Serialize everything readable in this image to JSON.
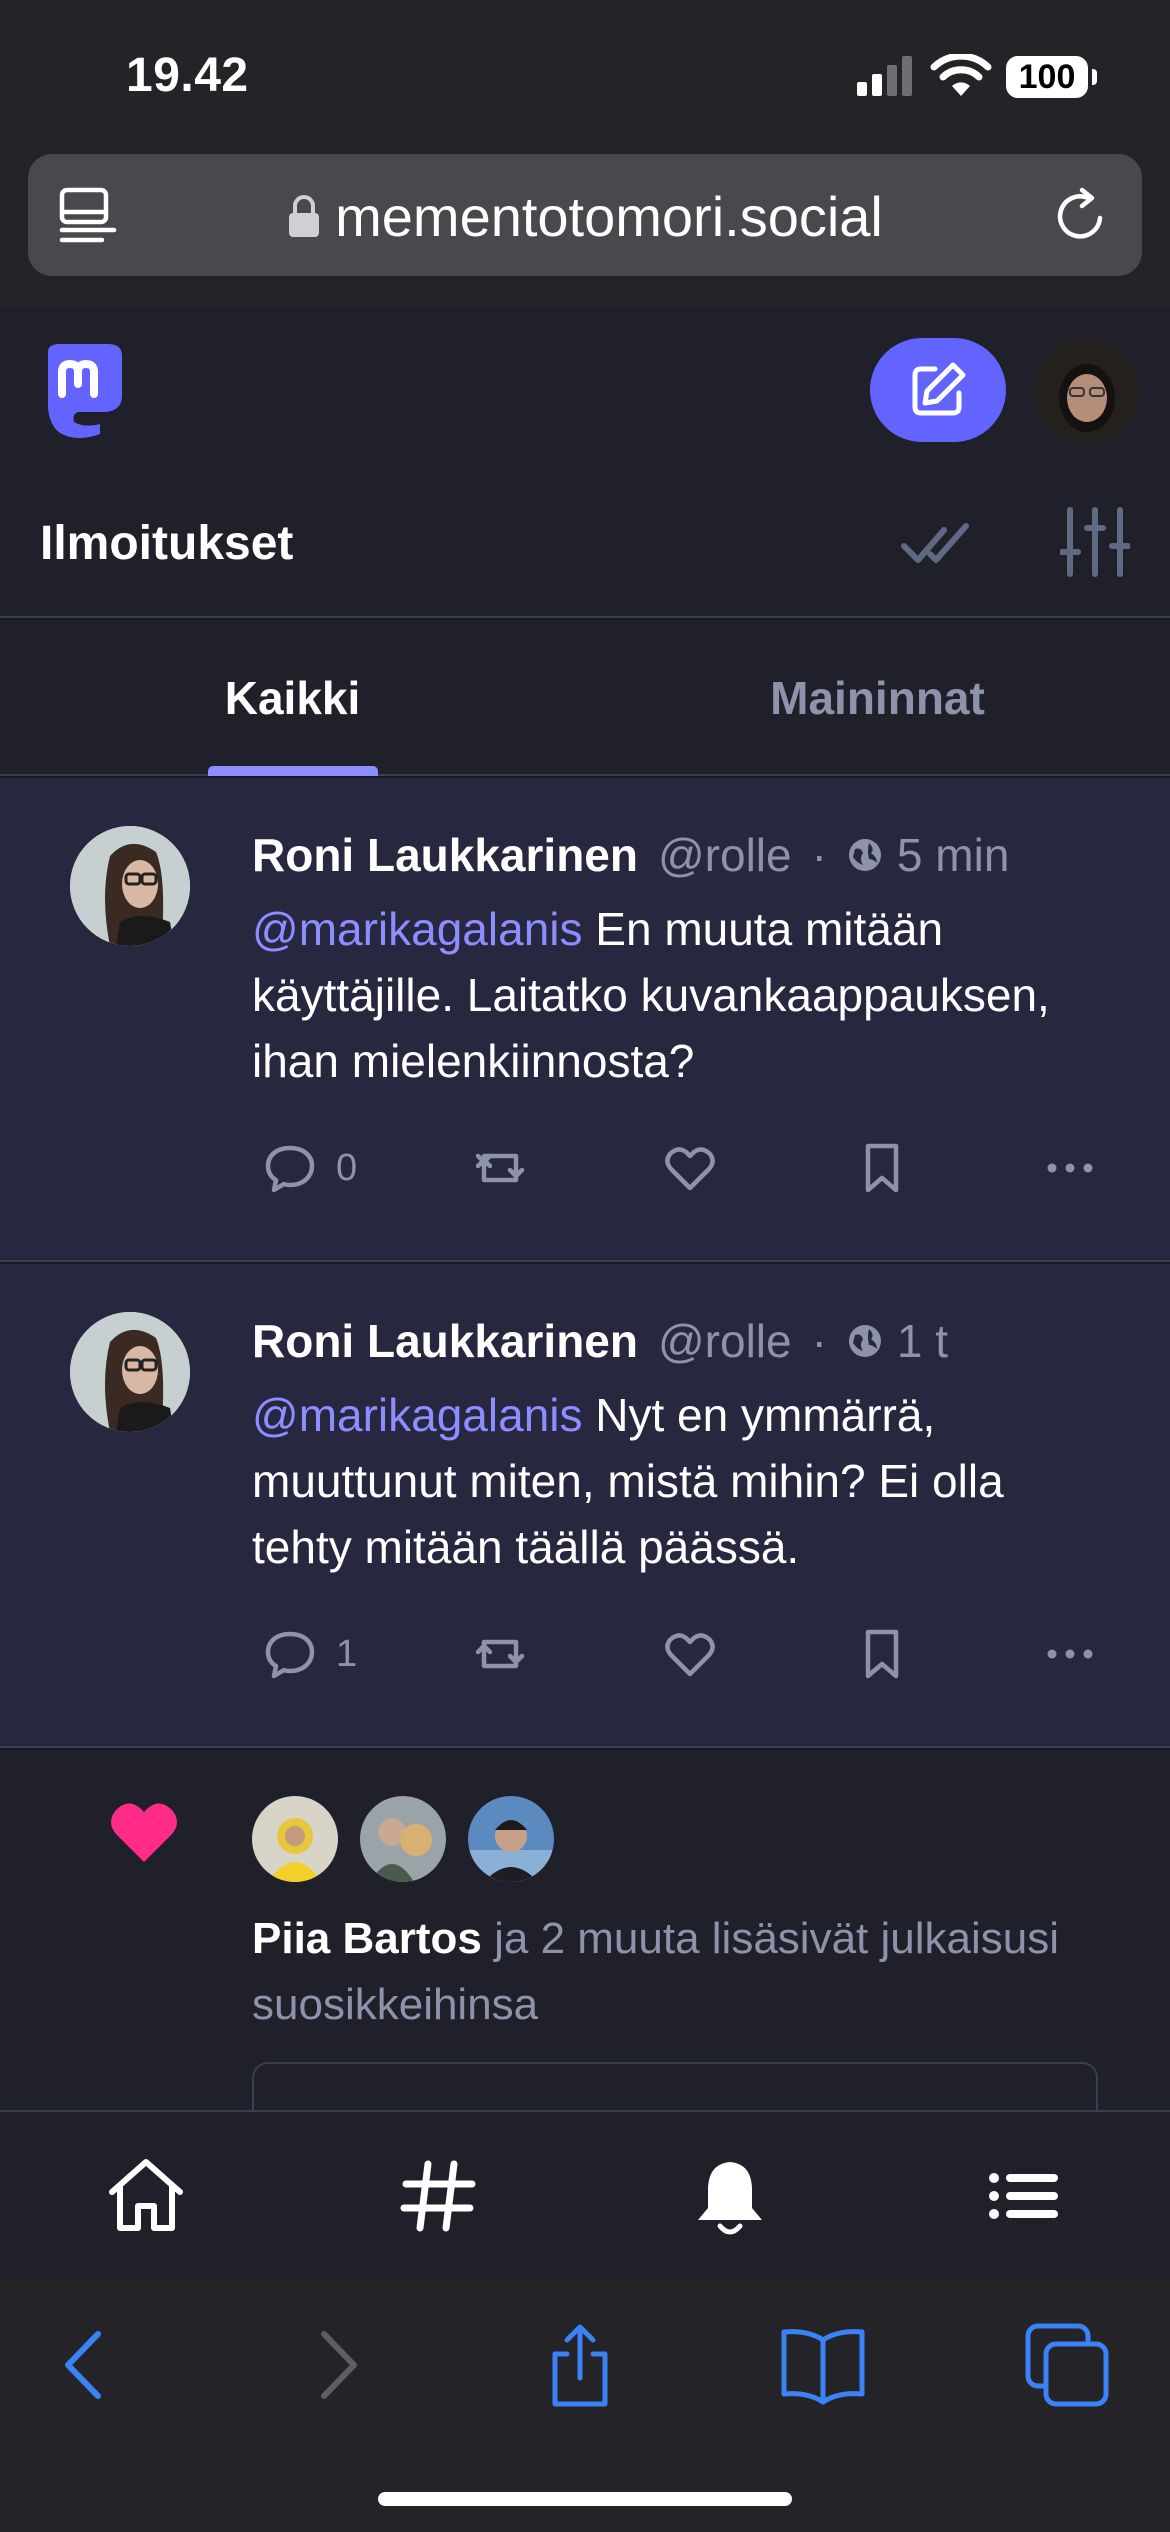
{
  "status_bar": {
    "time": "19.42",
    "battery": "100"
  },
  "browser": {
    "url": "mementotomori.social"
  },
  "column": {
    "title": "Ilmoitukset"
  },
  "tabs": [
    {
      "label": "Kaikki",
      "active": true
    },
    {
      "label": "Maininnat",
      "active": false
    }
  ],
  "notifications": [
    {
      "display_name": "Roni Laukkarinen",
      "handle": "@rolle",
      "separator": "·",
      "time": "5 min",
      "mention": "@marikagalanis",
      "text": " En muuta mitään käyttäjille. Laitatko kuvankaappauksen, ihan mielenkiinnosta?",
      "reply_count": "0"
    },
    {
      "display_name": "Roni Laukkarinen",
      "handle": "@rolle",
      "separator": "·",
      "time": "1 t",
      "mention": "@marikagalanis",
      "text": " Nyt en ymmärrä, muuttunut miten, mistä mihin? Ei olla tehty mitään täällä päässä.",
      "reply_count": "1"
    }
  ],
  "favourite_notification": {
    "actor": "Piia Bartos",
    "text": " ja 2 muuta lisäsivät julkaisusi suosikkeihinsa"
  },
  "colors": {
    "accent": "#6364ff",
    "mention": "#8c8dff",
    "heart": "#ff2b87",
    "unread_bg": "#27273f",
    "safari_blue": "#3b82f6"
  },
  "icons": [
    "reader-icon",
    "lock-icon",
    "reload-icon",
    "mastodon-logo",
    "compose-icon",
    "check-all-icon",
    "sliders-icon",
    "globe-icon",
    "reply-icon",
    "boost-icon",
    "star-heart-icon",
    "bookmark-icon",
    "more-icon",
    "heart-icon",
    "home-icon",
    "hashtag-icon",
    "bell-icon",
    "list-icon",
    "back-icon",
    "forward-icon",
    "share-icon",
    "bookmarks-icon",
    "tabs-icon"
  ]
}
